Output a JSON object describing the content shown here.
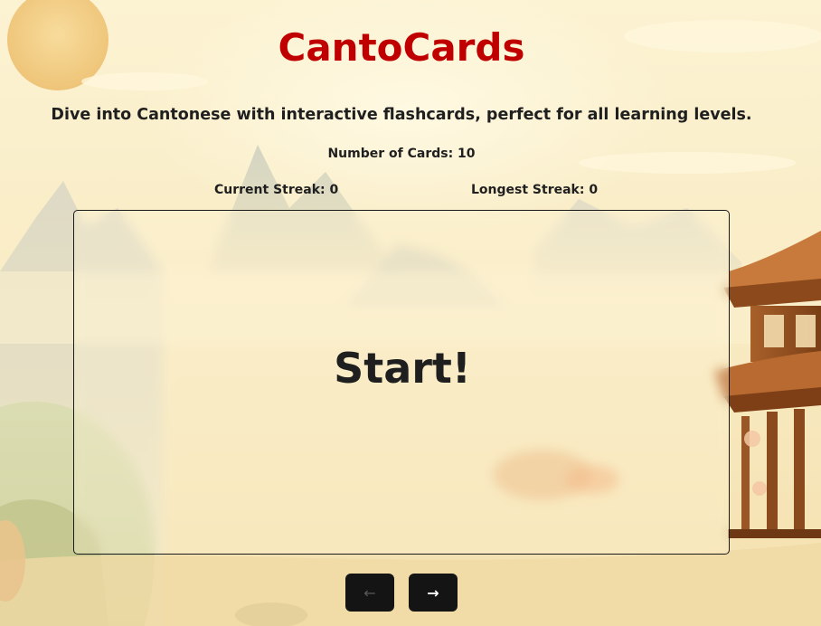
{
  "app": {
    "title": "CantoCards",
    "subtitle": "Dive into Cantonese with interactive flashcards, perfect for all learning levels."
  },
  "stats": {
    "card_count_text": "Number of Cards: 10",
    "current_streak_text": "Current Streak: 0",
    "longest_streak_text": "Longest Streak: 0"
  },
  "flashcard": {
    "text": "Start!"
  },
  "navigation": {
    "prev_label": "←",
    "next_label": "→",
    "prev_icon": "arrow-left-icon",
    "next_icon": "arrow-right-icon"
  },
  "theme": {
    "title_color": "#c00000",
    "button_color": "#141414",
    "background_color": "#fbefc9"
  }
}
